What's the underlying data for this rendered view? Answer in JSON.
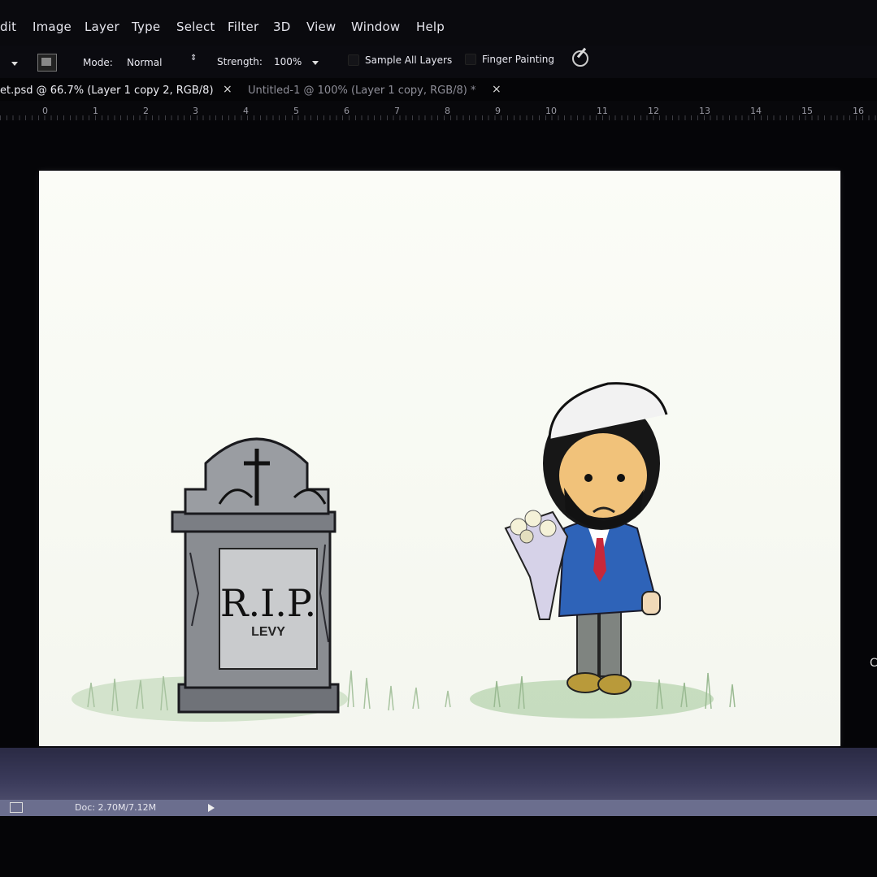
{
  "menubar": {
    "items": [
      "dit",
      "Image",
      "Layer",
      "Type",
      "Select",
      "Filter",
      "3D",
      "View",
      "Window",
      "Help"
    ]
  },
  "options": {
    "mode_label": "Mode:",
    "mode_value": "Normal",
    "strength_label": "Strength:",
    "strength_value": "100%",
    "sample_all_layers": "Sample All Layers",
    "finger_painting": "Finger Painting"
  },
  "tabs": [
    {
      "label": "et.psd @ 66.7% (Layer 1 copy 2, RGB/8)",
      "active": true
    },
    {
      "label": "Untitled-1 @ 100% (Layer 1 copy, RGB/8) *",
      "active": false
    }
  ],
  "tab_close": "×",
  "ruler": {
    "numbers": [
      "0",
      "1",
      "2",
      "3",
      "4",
      "5",
      "6",
      "7",
      "8",
      "9",
      "10",
      "11",
      "12",
      "13",
      "14",
      "15",
      "16"
    ]
  },
  "canvas": {
    "tombstone": {
      "line1": "R.I.P.",
      "line2": "LEVY"
    }
  },
  "status": {
    "doc_size": "Doc: 2.70M/7.12M"
  },
  "edge_glyph": "C"
}
